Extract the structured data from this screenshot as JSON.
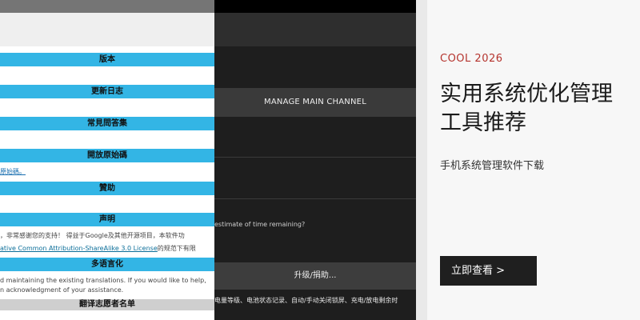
{
  "left_panel": {
    "sections": [
      {
        "label": "版本"
      },
      {
        "label": "更新日志"
      },
      {
        "label": "常見問答集"
      },
      {
        "label": "開放原始碼"
      },
      {
        "label": "贊助"
      },
      {
        "label": "声明"
      },
      {
        "label": "多语言化"
      },
      {
        "label": "翻译志愿者名单"
      }
    ],
    "open_source_link": "原始碼。",
    "statement_line1": "，非常感谢您的支持！ 得益于Google及其他开源项目，本软件功",
    "statement_line2_link": "ative Common Attribution-ShareAlike 3.0 License",
    "statement_line2_tail": "的规范下有限",
    "translation_line1": "d maintaining the existing translations. If you would like to help,",
    "translation_line2": "n acknowledgment of your assistance."
  },
  "middle_panel": {
    "manage_button": "MANAGE MAIN CHANNEL",
    "question_text": "estimate of time remaining?",
    "upgrade_button": "升级/捐助...",
    "features_text": "电量等级、电池状态记录、自动/手动关闭锁屏、充电/放电剩余时"
  },
  "promo": {
    "tag": "COOL 2026",
    "title": "实用系统优化管理工具推荐",
    "subtitle": "手机系统管理软件下载",
    "cta": "立即查看 >"
  },
  "colors": {
    "section_header": "#33b5e5",
    "tag": "#b5342e",
    "cta_bg": "#1f1f1f"
  }
}
